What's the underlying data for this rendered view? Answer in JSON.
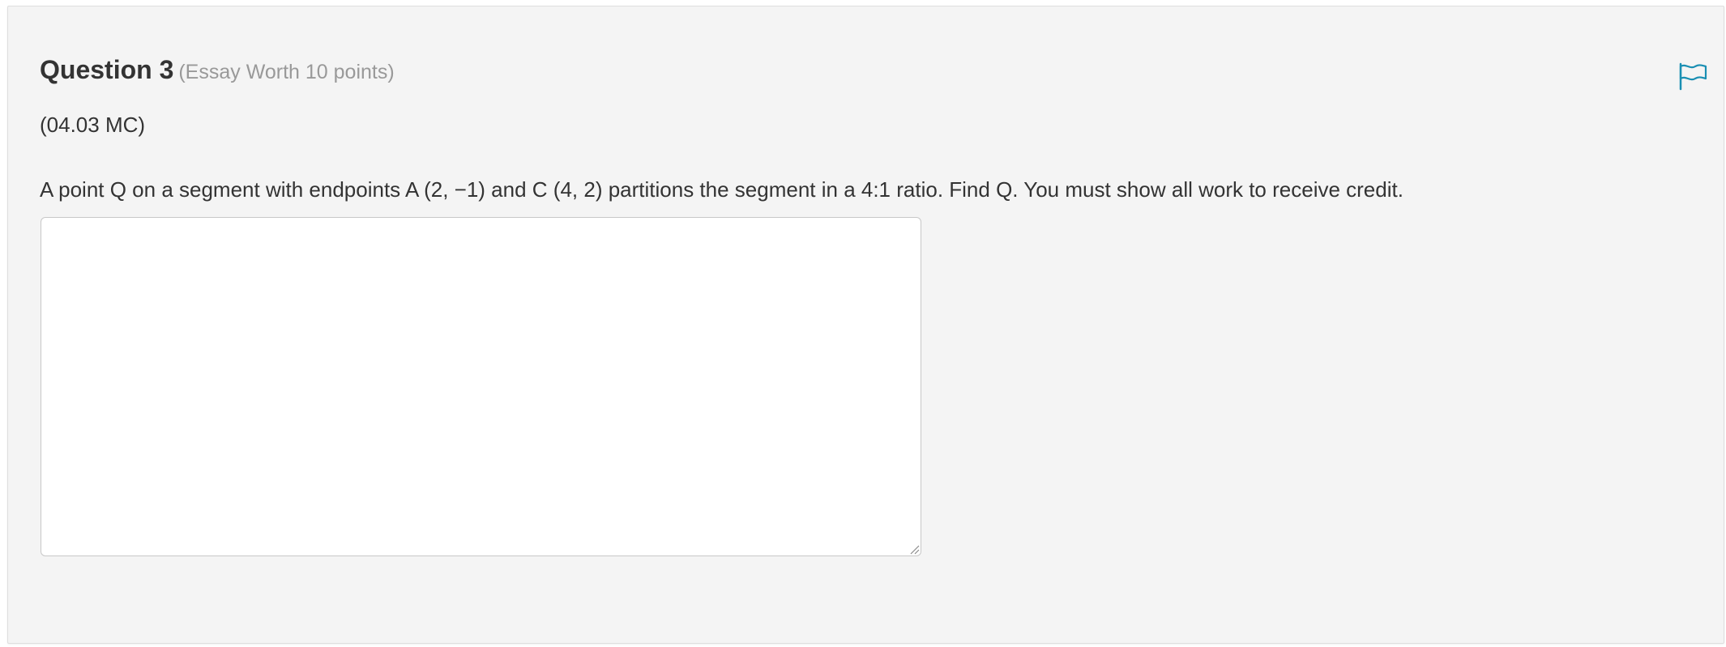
{
  "question": {
    "title": "Question 3",
    "worth": "(Essay Worth 10 points)",
    "code": "(04.03 MC)",
    "prompt": "A point Q on a segment with endpoints A (2, −1) and C (4, 2) partitions the segment in a 4:1 ratio. Find Q. You must show all work to receive credit."
  },
  "answer": {
    "value": "",
    "placeholder": ""
  },
  "icons": {
    "flag": "flag-icon",
    "resize": "resize-grip-icon"
  },
  "colors": {
    "accent": "#1a8fb3",
    "card_background": "#f4f4f4",
    "text": "#333333",
    "muted_text": "#999999"
  }
}
